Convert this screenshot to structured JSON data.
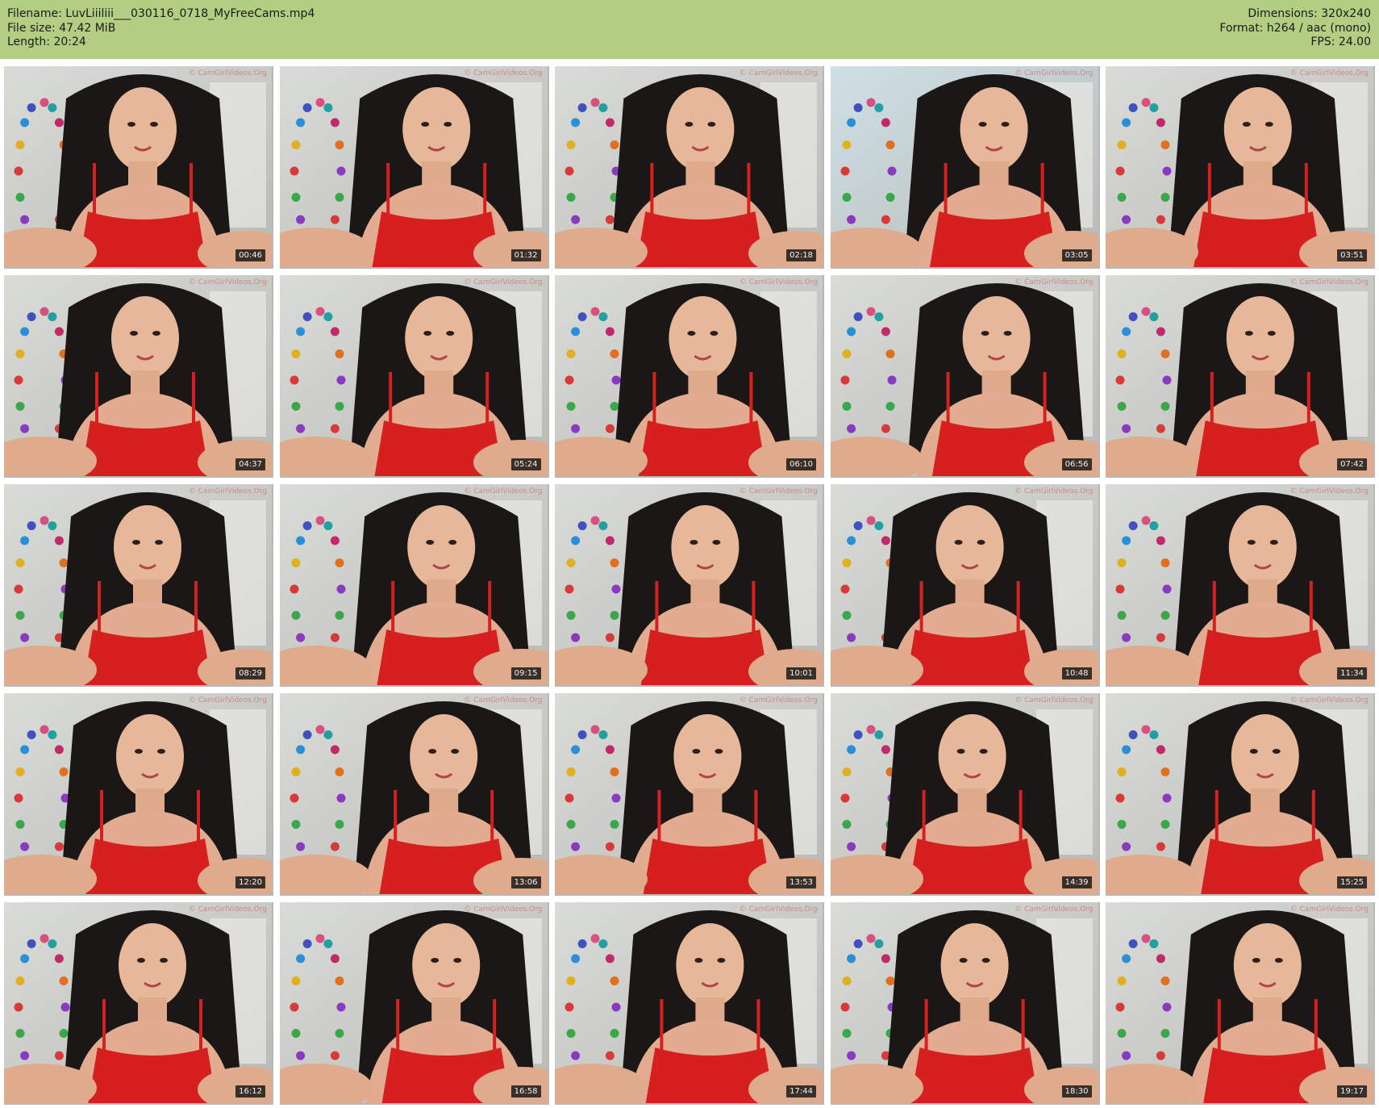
{
  "header": {
    "filename_line": "Filename: LuvLiiiliii___030116_0718_MyFreeCams.mp4",
    "filesize_line": "File size: 47.42 MiB",
    "length_line": "Length: 20:24",
    "dimensions_line": "Dimensions: 320x240",
    "format_line": "Format: h264 / aac (mono)",
    "fps_line": "FPS: 24.00"
  },
  "colors": {
    "header_bg": "#b3cd83",
    "top_color": "#d62020"
  },
  "watermark": "© CamGirlVideos.Org",
  "thumbnails": [
    {
      "timestamp": "00:46"
    },
    {
      "timestamp": "01:32"
    },
    {
      "timestamp": "02:18"
    },
    {
      "timestamp": "03:05"
    },
    {
      "timestamp": "03:51"
    },
    {
      "timestamp": "04:37"
    },
    {
      "timestamp": "05:24"
    },
    {
      "timestamp": "06:10"
    },
    {
      "timestamp": "06:56"
    },
    {
      "timestamp": "07:42"
    },
    {
      "timestamp": "08:29"
    },
    {
      "timestamp": "09:15"
    },
    {
      "timestamp": "10:01"
    },
    {
      "timestamp": "10:48"
    },
    {
      "timestamp": "11:34"
    },
    {
      "timestamp": "12:20"
    },
    {
      "timestamp": "13:06"
    },
    {
      "timestamp": "13:53"
    },
    {
      "timestamp": "14:39"
    },
    {
      "timestamp": "15:25"
    },
    {
      "timestamp": "16:12"
    },
    {
      "timestamp": "16:58"
    },
    {
      "timestamp": "17:44"
    },
    {
      "timestamp": "18:30"
    },
    {
      "timestamp": "19:17"
    }
  ]
}
